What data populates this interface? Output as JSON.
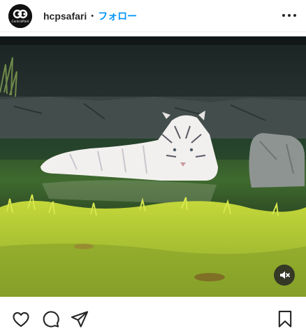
{
  "post": {
    "username": "hcpsafari",
    "separator": "•",
    "follow_label": "フォロー",
    "logo_text": "CentralPark"
  },
  "icons": {
    "more": "more-horizontal-icon",
    "mute": "volume-muted-icon",
    "like": "heart-icon",
    "comment": "comment-icon",
    "share": "send-icon",
    "save": "bookmark-icon"
  },
  "colors": {
    "accent": "#0095f6",
    "text": "#262626"
  }
}
